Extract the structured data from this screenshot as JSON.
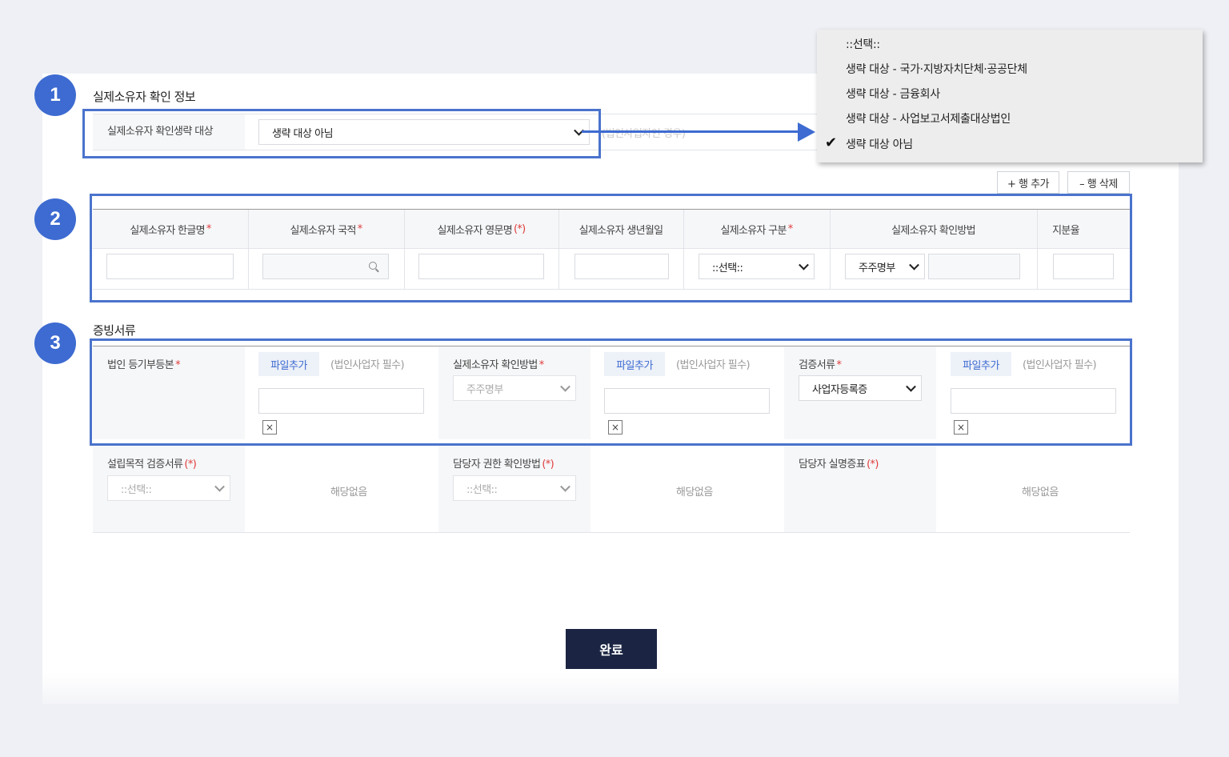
{
  "step_badges": [
    "1",
    "2",
    "3"
  ],
  "section1": {
    "title": "실제소유자 확인 정보",
    "exempt_label": "실제소유자 확인생략 대상",
    "exempt_value": "생략 대상 아님",
    "behind_text": "(법인사업자인 경우)"
  },
  "dropdown": {
    "options": [
      "::선택::",
      "생략 대상 - 국가·지방자치단체·공공단체",
      "생략 대상 - 금융회사",
      "생략 대상 - 사업보고서제출대상법인",
      "생략 대상 아님"
    ],
    "selected_index": 4,
    "check_mark": "✔"
  },
  "row_buttons": {
    "add": "+ 행 추가",
    "delete": "– 행 삭제"
  },
  "owner_table": {
    "columns": [
      {
        "label": "실제소유자 한글명",
        "mark": "*"
      },
      {
        "label": "실제소유자 국적",
        "mark": "*"
      },
      {
        "label": "실제소유자 영문명",
        "mark": "(*)"
      },
      {
        "label": "실제소유자 생년월일",
        "mark": ""
      },
      {
        "label": "실제소유자 구분",
        "mark": "*"
      },
      {
        "label": "실제소유자 확인방법",
        "mark": ""
      },
      {
        "label": "지분율",
        "mark": ""
      }
    ],
    "type_select": "::선택::",
    "method_select": "주주명부"
  },
  "section3": {
    "title": "증빙서류",
    "add_file": "파일추가",
    "hint": "(법인사업자 필수)",
    "x_mark": "×",
    "none_text": "해당없음",
    "row1": [
      {
        "label": "법인 등기부등본",
        "mark": "*"
      },
      {
        "label": "실제소유자 확인방법",
        "mark": "*",
        "select": "주주명부"
      },
      {
        "label": "검증서류",
        "mark": "*",
        "select": "사업자등록증"
      }
    ],
    "row2": [
      {
        "label": "설립목적 검증서류",
        "mark": "(*)",
        "select": "::선택::"
      },
      {
        "label": "담당자 권한 확인방법",
        "mark": "(*)",
        "select": "::선택::"
      },
      {
        "label": "담당자 실명증표",
        "mark": "(*)"
      }
    ]
  },
  "done_button": "완료"
}
